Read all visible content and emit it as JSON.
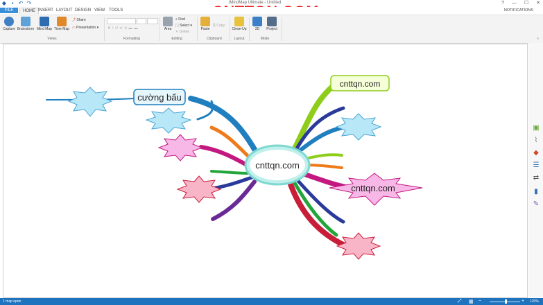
{
  "window": {
    "title": "iMindMap Ultimate - Untitled",
    "watermark": "CNTTQN.COM",
    "minimize": "—",
    "maximize": "☐",
    "close": "✕"
  },
  "quick_access": [
    "save-icon",
    "undo-icon",
    "redo-icon"
  ],
  "menu": {
    "file": "FILE",
    "tabs": [
      "HOME",
      "INSERT",
      "LAYOUT",
      "DESIGN",
      "VIEW",
      "TOOLS"
    ],
    "notifications": "NOTIFICATIONS"
  },
  "ribbon": {
    "views": {
      "label": "Views",
      "capture": "Capture",
      "brainstorm": "Brainstorm",
      "mind_map": "Mind Map",
      "time_map": "Time Map",
      "share": "Share",
      "presentation": "Presentation"
    },
    "formatting": {
      "label": "Formatting"
    },
    "editing": {
      "label": "Editing",
      "area": "Area",
      "find": "Find",
      "select": "Select",
      "delete": "Delete"
    },
    "clipboard": {
      "label": "Clipboard",
      "paste": "Paste",
      "copy": "Copy"
    },
    "layout": {
      "label": "Layout",
      "clean_up": "Clean-Up"
    },
    "mode": {
      "label": "Mode",
      "three_d": "3D",
      "project": "Project"
    }
  },
  "mindmap": {
    "central": "cnttqn.com",
    "topic_top_right": "cnttqn.com",
    "topic_right": "cnttqn.com",
    "topic_left": "cường bấu"
  },
  "colors": {
    "accent": "#1e73be",
    "file_tab": "#3a8fd8",
    "star_blue": "#b8e8f8",
    "star_pink": "#f7b7e7",
    "star_red": "#f9b5c8",
    "branch_green": "#8fcd1b",
    "branch_blue": "#1f7fbf",
    "branch_navy": "#2a3a9a",
    "branch_magenta": "#c2187f",
    "branch_orange": "#ef7a1a",
    "branch_purple": "#6a2a96",
    "branch_red": "#c91e3a"
  },
  "status": {
    "pages": "1 map open",
    "zoom": "120%"
  }
}
